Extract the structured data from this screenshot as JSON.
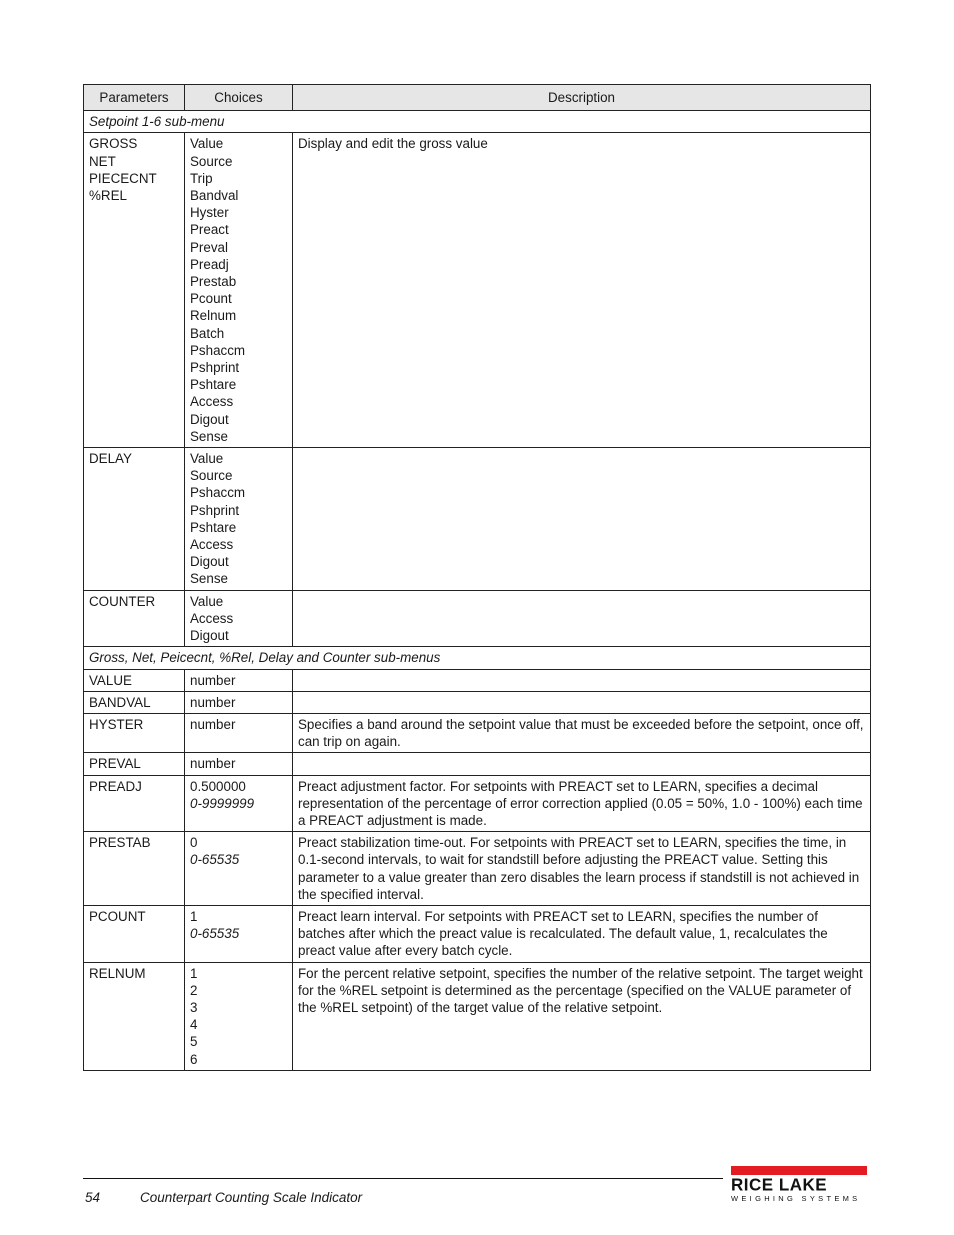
{
  "table": {
    "headers": [
      "Parameters",
      "Choices",
      "Description"
    ],
    "sections": [
      {
        "title": "Setpoint 1-6 sub-menu",
        "rows": [
          {
            "params": [
              "GROSS",
              "NET",
              "PIECECNT",
              "%REL"
            ],
            "choices": [
              "Value",
              "Source",
              "Trip",
              "Bandval",
              "Hyster",
              "Preact",
              "Preval",
              "Preadj",
              "Prestab",
              "Pcount",
              "Relnum",
              "Batch",
              "Pshaccm",
              "Pshprint",
              "Pshtare",
              "Access",
              "Digout",
              "Sense"
            ],
            "description": "Display and edit the gross value"
          },
          {
            "params": [
              "DELAY"
            ],
            "choices": [
              "Value",
              "Source",
              "Pshaccm",
              "Pshprint",
              "Pshtare",
              "Access",
              "Digout",
              "Sense"
            ],
            "description": ""
          },
          {
            "params": [
              "COUNTER"
            ],
            "choices": [
              "Value",
              "Access",
              "Digout"
            ],
            "description": ""
          }
        ]
      },
      {
        "title": "Gross, Net, Peicecnt, %Rel, Delay and Counter sub-menus",
        "rows": [
          {
            "params": [
              "VALUE"
            ],
            "choices": [
              "number"
            ],
            "range": "",
            "description": ""
          },
          {
            "params": [
              "BANDVAL"
            ],
            "choices": [
              "number"
            ],
            "range": "",
            "description": ""
          },
          {
            "params": [
              "HYSTER"
            ],
            "choices": [
              "number"
            ],
            "range": "",
            "description": "Specifies a band around the setpoint value that must be exceeded before the setpoint, once off, can trip on again."
          },
          {
            "params": [
              "PREVAL"
            ],
            "choices": [
              "number"
            ],
            "range": "",
            "description": ""
          },
          {
            "params": [
              "PREADJ"
            ],
            "choices": [
              "0.500000"
            ],
            "range": "0-9999999",
            "description": "Preact adjustment factor. For setpoints with PREACT set to LEARN, specifies a decimal representation of the percentage of error correction applied (0.05 = 50%, 1.0 - 100%) each time a PREACT adjustment is made."
          },
          {
            "params": [
              "PRESTAB"
            ],
            "choices": [
              "0"
            ],
            "range": "0-65535",
            "description": "Preact stabilization time-out. For setpoints with PREACT set to LEARN, specifies the time, in 0.1-second intervals, to wait for standstill before adjusting the PREACT value. Setting this parameter to a value greater than zero disables the learn process if standstill is not achieved in the specified interval."
          },
          {
            "params": [
              "PCOUNT"
            ],
            "choices": [
              "1"
            ],
            "range": "0-65535",
            "description": "Preact learn interval. For setpoints with PREACT set to LEARN, specifies the number of batches after which the preact value is recalculated. The default value, 1, recalculates the preact value after every batch cycle."
          },
          {
            "params": [
              "RELNUM"
            ],
            "choices": [
              "1",
              "2",
              "3",
              "4",
              "5",
              "6"
            ],
            "range": "",
            "description": "For the percent relative setpoint, specifies the number of the relative setpoint. The target weight for the %REL setpoint is determined as the percentage (specified on the VALUE parameter of the %REL setpoint) of the target value of the relative setpoint."
          }
        ]
      }
    ]
  },
  "footer": {
    "page_number": "54",
    "document_title": "Counterpart Counting Scale Indicator",
    "logo": {
      "name": "RICE LAKE",
      "tagline": "WEIGHING SYSTEMS",
      "brand_color": "#e31b23"
    }
  }
}
